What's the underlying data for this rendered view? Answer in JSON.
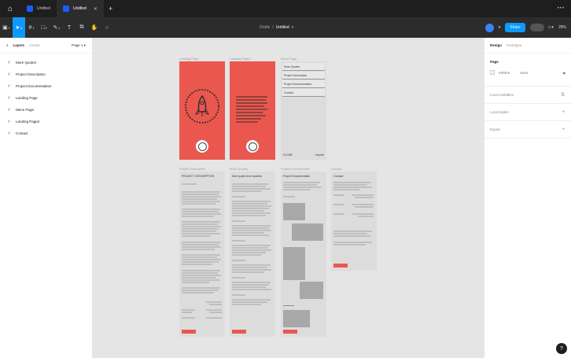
{
  "tabbar": {
    "tabs": [
      {
        "label": "Untitled"
      },
      {
        "label": "Untitled",
        "active": true
      }
    ]
  },
  "toolbar": {
    "breadcrumb_folder": "Drafts",
    "breadcrumb_sep": "/",
    "file_name": "Untitled",
    "share_label": "Share",
    "zoom": "28%"
  },
  "left_panel": {
    "layers_tab": "Layers",
    "assets_tab": "Assets",
    "page_selector": "Page 1",
    "layers": [
      {
        "icon": "frame-icon",
        "label": "More Quotes"
      },
      {
        "icon": "frame-icon",
        "label": "Project Description"
      },
      {
        "icon": "frame-icon",
        "label": "Project Documentation"
      },
      {
        "icon": "frame-icon",
        "label": "Landing Page"
      },
      {
        "icon": "frame-icon",
        "label": "Menu Page"
      },
      {
        "icon": "frame-icon",
        "label": "Landing Page2"
      },
      {
        "icon": "frame-icon",
        "label": "Contact"
      }
    ]
  },
  "canvas": {
    "frames": {
      "landing_page": {
        "title": "Landing Page"
      },
      "landing_page2": {
        "title": "Landing Page2"
      },
      "menu_page": {
        "title": "Menu Page",
        "items": [
          "More Quotes",
          "Project Description",
          "Project Documentation",
          "Contact"
        ],
        "footer_left": "CLOSE",
        "footer_right": "Imprint"
      },
      "project_description": {
        "title": "Project Description",
        "heading": "PROJECT DESCRIPTION"
      },
      "more_quotes": {
        "title": "More Quotes",
        "heading": "More quotes from students"
      },
      "project_documentation": {
        "title": "Project Documentati...",
        "heading": "Project Documentation"
      },
      "contact": {
        "title": "Contact",
        "heading": "Contact"
      }
    }
  },
  "right_panel": {
    "design_tab": "Design",
    "prototype_tab": "Prototype",
    "page_label": "Page",
    "page_color": "F5F5F5",
    "page_opacity": "100%",
    "local_variables": "Local variables",
    "local_styles": "Local styles",
    "export": "Export"
  },
  "colors": {
    "accent": "#0d99ff",
    "frame_red": "#ea574f",
    "toolbar_bg": "#2c2c2c",
    "tabbar_bg": "#1e1e1e"
  }
}
